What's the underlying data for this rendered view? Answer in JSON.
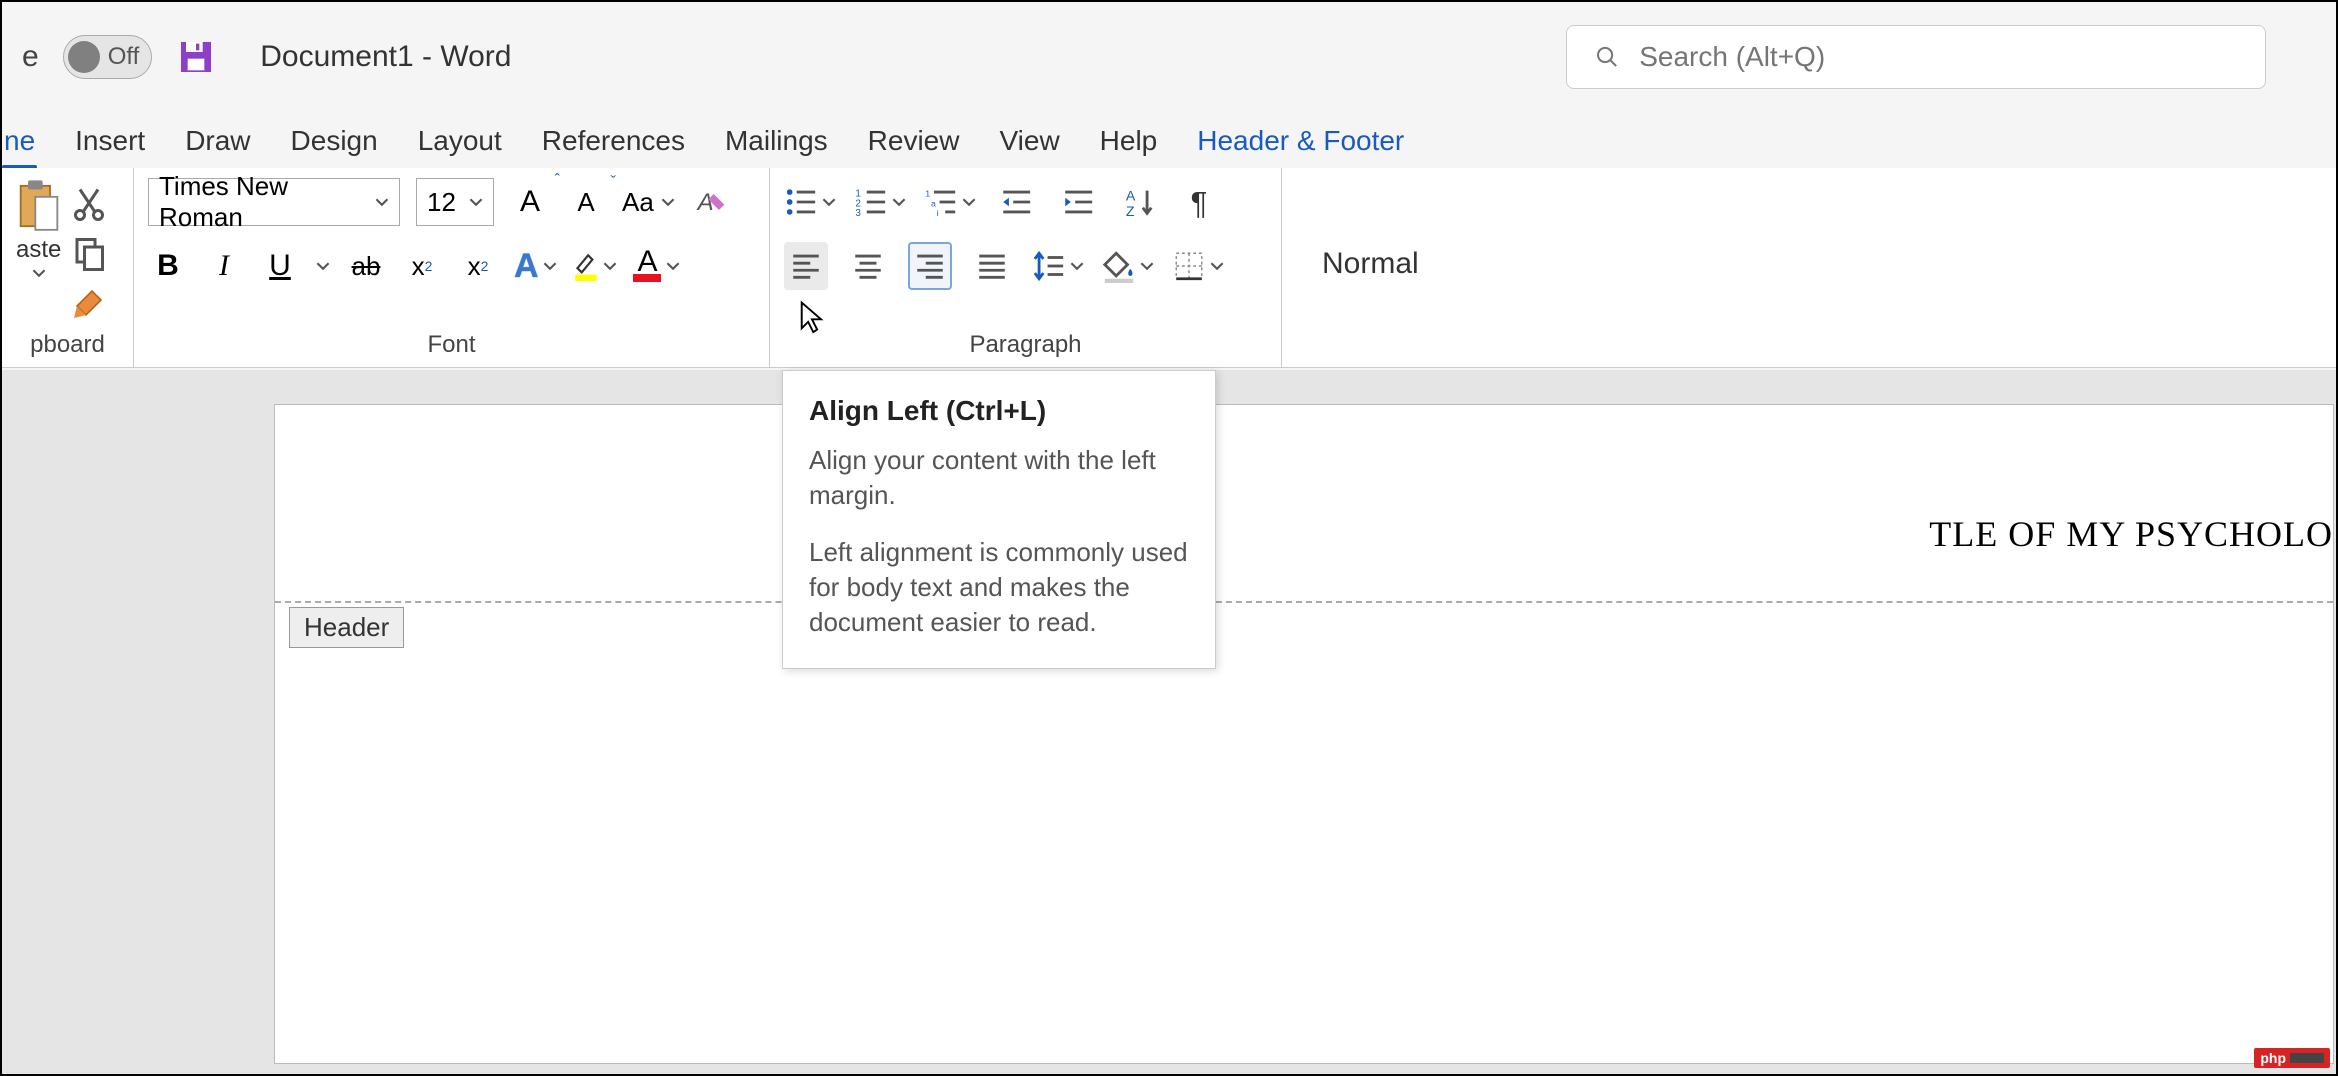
{
  "titlebar": {
    "autosave_label": "Off",
    "document_title": "Document1  -  Word",
    "search_placeholder": "Search (Alt+Q)"
  },
  "tabs": {
    "home_partial": "ne",
    "insert": "Insert",
    "draw": "Draw",
    "design": "Design",
    "layout": "Layout",
    "references": "References",
    "mailings": "Mailings",
    "review": "Review",
    "view": "View",
    "help": "Help",
    "header_footer": "Header & Footer"
  },
  "ribbon": {
    "clipboard": {
      "label": "pboard",
      "paste": "aste"
    },
    "font": {
      "label": "Font",
      "font_name": "Times New Roman",
      "font_size": "12",
      "case_btn": "Aa",
      "bold": "B",
      "italic": "I",
      "underline": "U",
      "strike": "ab",
      "subscript": "x",
      "superscript": "x"
    },
    "paragraph": {
      "label": "Paragraph"
    },
    "styles": {
      "normal": "Normal"
    }
  },
  "tooltip": {
    "title": "Align Left (Ctrl+L)",
    "line1": "Align your content with the left margin.",
    "line2": "Left alignment is commonly used for body text and makes the document easier to read."
  },
  "document": {
    "header_tag": "Header",
    "visible_text": "TLE OF MY PSYCHOLO"
  },
  "watermark": {
    "text": "php"
  }
}
